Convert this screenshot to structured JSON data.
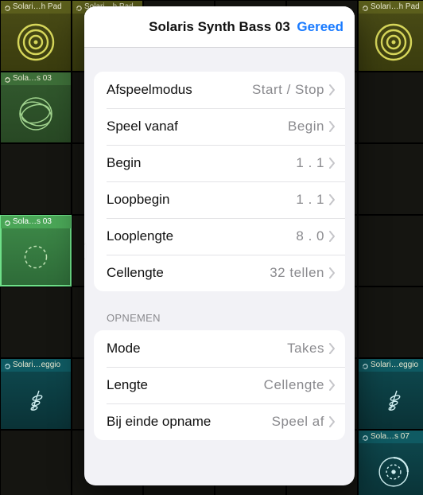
{
  "grid": {
    "cells": {
      "r0c0": "Solari…h Pad",
      "r0c1": "Solari…h Pad",
      "r0c5": "Solari…h Pad",
      "r1c0": "Sola…s 03",
      "r3c0": "Sola…s 03",
      "r5c0": "Solari…eggio",
      "r5c5": "Solari…eggio",
      "r6c5": "Sola…s 07"
    }
  },
  "popover": {
    "title": "Solaris Synth Bass 03",
    "done": "Gereed",
    "group1": [
      {
        "label": "Afspeelmodus",
        "value": "Start / Stop"
      },
      {
        "label": "Speel vanaf",
        "value": "Begin"
      },
      {
        "label": "Begin",
        "value": "1 . 1"
      },
      {
        "label": "Loopbegin",
        "value": "1 . 1"
      },
      {
        "label": "Looplengte",
        "value": "8 . 0"
      },
      {
        "label": "Cellengte",
        "value": "32 tellen"
      }
    ],
    "section2_header": "OPNEMEN",
    "group2": [
      {
        "label": "Mode",
        "value": "Takes"
      },
      {
        "label": "Lengte",
        "value": "Cellengte"
      },
      {
        "label": "Bij einde opname",
        "value": "Speel af"
      }
    ]
  }
}
